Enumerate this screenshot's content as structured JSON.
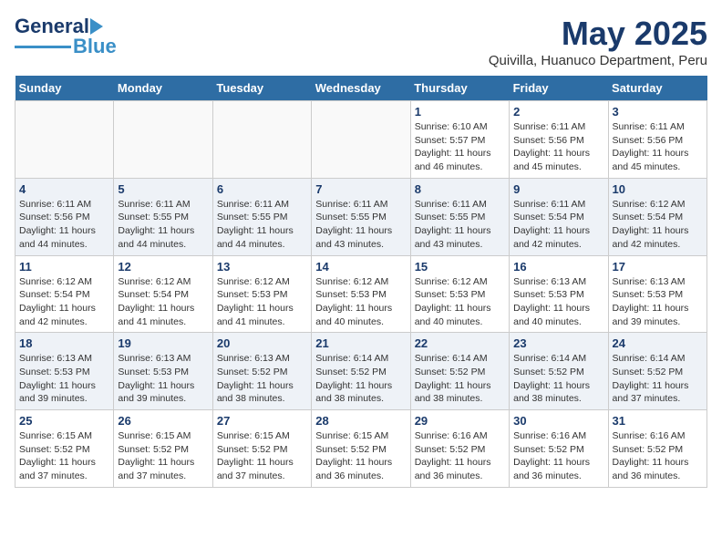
{
  "header": {
    "logo_general": "General",
    "logo_blue": "Blue",
    "month_title": "May 2025",
    "location": "Quivilla, Huanuco Department, Peru"
  },
  "days_of_week": [
    "Sunday",
    "Monday",
    "Tuesday",
    "Wednesday",
    "Thursday",
    "Friday",
    "Saturday"
  ],
  "weeks": [
    [
      {
        "day": "",
        "info": ""
      },
      {
        "day": "",
        "info": ""
      },
      {
        "day": "",
        "info": ""
      },
      {
        "day": "",
        "info": ""
      },
      {
        "day": "1",
        "info": "Sunrise: 6:10 AM\nSunset: 5:57 PM\nDaylight: 11 hours\nand 46 minutes."
      },
      {
        "day": "2",
        "info": "Sunrise: 6:11 AM\nSunset: 5:56 PM\nDaylight: 11 hours\nand 45 minutes."
      },
      {
        "day": "3",
        "info": "Sunrise: 6:11 AM\nSunset: 5:56 PM\nDaylight: 11 hours\nand 45 minutes."
      }
    ],
    [
      {
        "day": "4",
        "info": "Sunrise: 6:11 AM\nSunset: 5:56 PM\nDaylight: 11 hours\nand 44 minutes."
      },
      {
        "day": "5",
        "info": "Sunrise: 6:11 AM\nSunset: 5:55 PM\nDaylight: 11 hours\nand 44 minutes."
      },
      {
        "day": "6",
        "info": "Sunrise: 6:11 AM\nSunset: 5:55 PM\nDaylight: 11 hours\nand 44 minutes."
      },
      {
        "day": "7",
        "info": "Sunrise: 6:11 AM\nSunset: 5:55 PM\nDaylight: 11 hours\nand 43 minutes."
      },
      {
        "day": "8",
        "info": "Sunrise: 6:11 AM\nSunset: 5:55 PM\nDaylight: 11 hours\nand 43 minutes."
      },
      {
        "day": "9",
        "info": "Sunrise: 6:11 AM\nSunset: 5:54 PM\nDaylight: 11 hours\nand 42 minutes."
      },
      {
        "day": "10",
        "info": "Sunrise: 6:12 AM\nSunset: 5:54 PM\nDaylight: 11 hours\nand 42 minutes."
      }
    ],
    [
      {
        "day": "11",
        "info": "Sunrise: 6:12 AM\nSunset: 5:54 PM\nDaylight: 11 hours\nand 42 minutes."
      },
      {
        "day": "12",
        "info": "Sunrise: 6:12 AM\nSunset: 5:54 PM\nDaylight: 11 hours\nand 41 minutes."
      },
      {
        "day": "13",
        "info": "Sunrise: 6:12 AM\nSunset: 5:53 PM\nDaylight: 11 hours\nand 41 minutes."
      },
      {
        "day": "14",
        "info": "Sunrise: 6:12 AM\nSunset: 5:53 PM\nDaylight: 11 hours\nand 40 minutes."
      },
      {
        "day": "15",
        "info": "Sunrise: 6:12 AM\nSunset: 5:53 PM\nDaylight: 11 hours\nand 40 minutes."
      },
      {
        "day": "16",
        "info": "Sunrise: 6:13 AM\nSunset: 5:53 PM\nDaylight: 11 hours\nand 40 minutes."
      },
      {
        "day": "17",
        "info": "Sunrise: 6:13 AM\nSunset: 5:53 PM\nDaylight: 11 hours\nand 39 minutes."
      }
    ],
    [
      {
        "day": "18",
        "info": "Sunrise: 6:13 AM\nSunset: 5:53 PM\nDaylight: 11 hours\nand 39 minutes."
      },
      {
        "day": "19",
        "info": "Sunrise: 6:13 AM\nSunset: 5:53 PM\nDaylight: 11 hours\nand 39 minutes."
      },
      {
        "day": "20",
        "info": "Sunrise: 6:13 AM\nSunset: 5:52 PM\nDaylight: 11 hours\nand 38 minutes."
      },
      {
        "day": "21",
        "info": "Sunrise: 6:14 AM\nSunset: 5:52 PM\nDaylight: 11 hours\nand 38 minutes."
      },
      {
        "day": "22",
        "info": "Sunrise: 6:14 AM\nSunset: 5:52 PM\nDaylight: 11 hours\nand 38 minutes."
      },
      {
        "day": "23",
        "info": "Sunrise: 6:14 AM\nSunset: 5:52 PM\nDaylight: 11 hours\nand 38 minutes."
      },
      {
        "day": "24",
        "info": "Sunrise: 6:14 AM\nSunset: 5:52 PM\nDaylight: 11 hours\nand 37 minutes."
      }
    ],
    [
      {
        "day": "25",
        "info": "Sunrise: 6:15 AM\nSunset: 5:52 PM\nDaylight: 11 hours\nand 37 minutes."
      },
      {
        "day": "26",
        "info": "Sunrise: 6:15 AM\nSunset: 5:52 PM\nDaylight: 11 hours\nand 37 minutes."
      },
      {
        "day": "27",
        "info": "Sunrise: 6:15 AM\nSunset: 5:52 PM\nDaylight: 11 hours\nand 37 minutes."
      },
      {
        "day": "28",
        "info": "Sunrise: 6:15 AM\nSunset: 5:52 PM\nDaylight: 11 hours\nand 36 minutes."
      },
      {
        "day": "29",
        "info": "Sunrise: 6:16 AM\nSunset: 5:52 PM\nDaylight: 11 hours\nand 36 minutes."
      },
      {
        "day": "30",
        "info": "Sunrise: 6:16 AM\nSunset: 5:52 PM\nDaylight: 11 hours\nand 36 minutes."
      },
      {
        "day": "31",
        "info": "Sunrise: 6:16 AM\nSunset: 5:52 PM\nDaylight: 11 hours\nand 36 minutes."
      }
    ]
  ]
}
